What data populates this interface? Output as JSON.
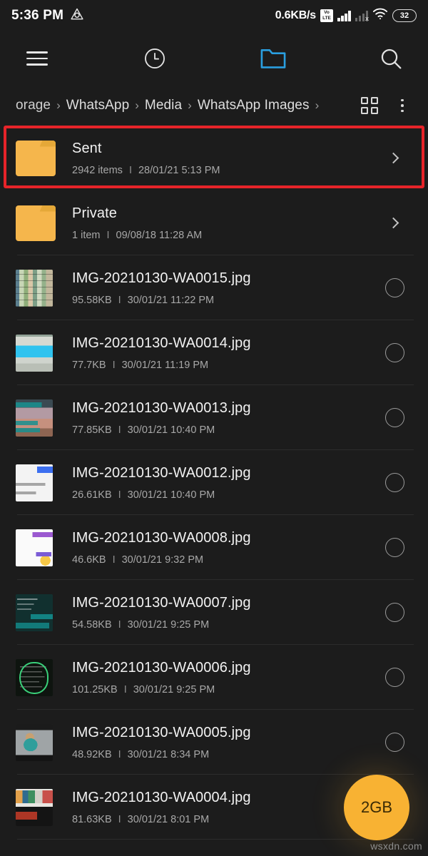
{
  "statusbar": {
    "time": "5:36 PM",
    "app_icon": "triangle-recycle-icon",
    "net_speed": "0.6KB/s",
    "volte_top": "Vo",
    "volte_bottom": "LTE",
    "sim2_x": "x",
    "battery_level": "32"
  },
  "toolbar": {
    "menu_icon": "hamburger-menu-icon",
    "recent_icon": "clock-icon",
    "folder_icon": "folder-icon",
    "search_icon": "search-icon",
    "active_accent": "#2a9fe0"
  },
  "breadcrumb": {
    "items": [
      {
        "label": "orage"
      },
      {
        "label": "WhatsApp"
      },
      {
        "label": "Media"
      },
      {
        "label": "WhatsApp Images"
      }
    ],
    "separator": "›",
    "grid_view_icon": "grid-view-icon",
    "overflow_icon": "more-vertical-icon"
  },
  "list": {
    "rows": [
      {
        "type": "folder",
        "name": "Sent",
        "info": "2942 items",
        "separator": "I",
        "timestamp": "28/01/21 5:13 PM",
        "trailing": "chevron-right-icon",
        "highlighted": true
      },
      {
        "type": "folder",
        "name": "Private",
        "info": "1 item",
        "separator": "I",
        "timestamp": "09/08/18 11:28 AM",
        "trailing": "chevron-right-icon",
        "highlighted": false
      },
      {
        "type": "file",
        "name": "IMG-20210130-WA0015.jpg",
        "info": "95.58KB",
        "separator": "I",
        "timestamp": "30/01/21 11:22 PM",
        "trailing": "selection-circle",
        "thumb": "photo-collage-grid"
      },
      {
        "type": "file",
        "name": "IMG-20210130-WA0014.jpg",
        "info": "77.7KB",
        "separator": "I",
        "timestamp": "30/01/21 11:19 PM",
        "trailing": "selection-circle",
        "thumb": "screenshot-cyan-banner"
      },
      {
        "type": "file",
        "name": "IMG-20210130-WA0013.jpg",
        "info": "77.85KB",
        "separator": "I",
        "timestamp": "30/01/21 10:40 PM",
        "trailing": "selection-circle",
        "thumb": "screenshot-teal-chat"
      },
      {
        "type": "file",
        "name": "IMG-20210130-WA0012.jpg",
        "info": "26.61KB",
        "separator": "I",
        "timestamp": "30/01/21 10:40 PM",
        "trailing": "selection-circle",
        "thumb": "screenshot-light-chat"
      },
      {
        "type": "file",
        "name": "IMG-20210130-WA0008.jpg",
        "info": "46.6KB",
        "separator": "I",
        "timestamp": "30/01/21 9:32 PM",
        "trailing": "selection-circle",
        "thumb": "screenshot-purple-chat"
      },
      {
        "type": "file",
        "name": "IMG-20210130-WA0007.jpg",
        "info": "54.58KB",
        "separator": "I",
        "timestamp": "30/01/21 9:25 PM",
        "trailing": "selection-circle",
        "thumb": "screenshot-dark-teal"
      },
      {
        "type": "file",
        "name": "IMG-20210130-WA0006.jpg",
        "info": "101.25KB",
        "separator": "I",
        "timestamp": "30/01/21 9:25 PM",
        "trailing": "selection-circle",
        "thumb": "screenshot-dark-green-doodle"
      },
      {
        "type": "file",
        "name": "IMG-20210130-WA0005.jpg",
        "info": "48.92KB",
        "separator": "I",
        "timestamp": "30/01/21 8:34 PM",
        "trailing": "selection-circle",
        "thumb": "photo-teddy-bear"
      },
      {
        "type": "file",
        "name": "IMG-20210130-WA0004.jpg",
        "info": "81.63KB",
        "separator": "I",
        "timestamp": "30/01/21 8:01 PM",
        "trailing": "selection-circle",
        "thumb": "photo-poster-collage"
      }
    ]
  },
  "fab": {
    "label": "2GB",
    "color": "#f8b233"
  },
  "watermark": {
    "text": "wsxdn.com"
  },
  "colors": {
    "background": "#1c1c1c",
    "folder_amber": "#f5b64c",
    "highlight_red": "#e62429",
    "accent_blue": "#2a9fe0"
  }
}
